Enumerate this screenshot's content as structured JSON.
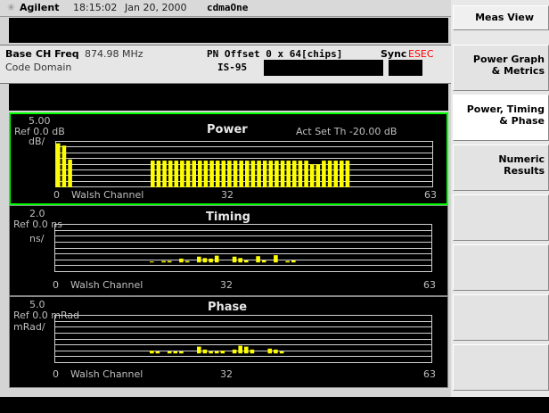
{
  "header": {
    "brand": "Agilent",
    "time": "18:15:02",
    "date": "Jan 20, 2000",
    "standard": "cdmaOne"
  },
  "info": {
    "base": "Base",
    "ch_freq_label": "CH Freq",
    "ch_freq_value": "874.98 MHz",
    "code_domain": "Code Domain",
    "pn_offset": "PN Offset 0 x 64[chips]",
    "is95": "IS-95",
    "sync_label": "Sync",
    "sync_value": "ESEC"
  },
  "colors": {
    "bar": "#ffff00",
    "sync_value": "#ff0000",
    "active_border": "#00ff00"
  },
  "softkeys": {
    "title": "Meas View",
    "items": [
      {
        "line1": "Power Graph",
        "line2": "& Metrics"
      },
      {
        "line1": "Power, Timing",
        "line2": "& Phase"
      },
      {
        "line1": "Numeric",
        "line2": "Results"
      },
      {
        "line1": "",
        "line2": ""
      },
      {
        "line1": "",
        "line2": ""
      },
      {
        "line1": "",
        "line2": ""
      },
      {
        "line1": "",
        "line2": ""
      }
    ]
  },
  "panels": [
    {
      "id": "power",
      "title": "Power",
      "ref": "Ref 0.0 dB",
      "scale": "5.00",
      "unit": "dB/",
      "extra": "Act Set Th  -20.00 dB",
      "x_start": "0",
      "x_axis_label": "Walsh Channel",
      "x_mid": "32",
      "x_end": "63"
    },
    {
      "id": "timing",
      "title": "Timing",
      "ref": "Ref 0.0 ns",
      "scale": "2.0",
      "unit": "ns/",
      "extra": "",
      "x_start": "0",
      "x_axis_label": "Walsh Channel",
      "x_mid": "32",
      "x_end": "63"
    },
    {
      "id": "phase",
      "title": "Phase",
      "ref": "Ref 0.0 mRad",
      "scale": "5.0",
      "unit": "mRad/",
      "extra": "",
      "x_start": "0",
      "x_axis_label": "Walsh Channel",
      "x_mid": "32",
      "x_end": "63"
    }
  ],
  "chart_data": [
    {
      "type": "bar",
      "title": "Power",
      "xlabel": "Walsh Channel",
      "ylabel": "dB",
      "x": [
        0,
        1,
        2,
        3,
        4,
        5,
        6,
        7,
        8,
        9,
        10,
        11,
        12,
        13,
        14,
        15,
        16,
        17,
        18,
        19,
        20,
        21,
        22,
        23,
        24,
        25,
        26,
        27,
        28,
        29,
        30,
        31,
        32,
        33,
        34,
        35,
        36,
        37,
        38,
        39,
        40,
        41,
        42,
        43,
        44,
        45,
        46,
        47,
        48,
        49,
        50,
        51,
        52,
        53,
        54,
        55,
        56,
        57,
        58,
        59,
        60,
        61,
        62,
        63
      ],
      "values": [
        -2,
        -4,
        -16,
        -40,
        -40,
        -40,
        -40,
        -40,
        -40,
        -40,
        -40,
        -40,
        -40,
        -40,
        -40,
        -40,
        -17,
        -17,
        -17,
        -17,
        -17,
        -17,
        -17,
        -17,
        -17,
        -17,
        -17,
        -17,
        -17,
        -17,
        -17,
        -17,
        -17,
        -17,
        -17,
        -17,
        -17,
        -17,
        -17,
        -17,
        -17,
        -17,
        -17,
        -20,
        -20,
        -17,
        -17,
        -17,
        -17,
        -17,
        -40,
        -40,
        -40,
        -40,
        -40,
        -40,
        -40,
        -40,
        -40,
        -40,
        -40,
        -40,
        -40,
        -40
      ],
      "baseline": -40,
      "xlim": [
        0,
        63
      ]
    },
    {
      "type": "bar",
      "title": "Timing",
      "xlabel": "Walsh Channel",
      "ylabel": "ns",
      "x": [
        16,
        18,
        19,
        21,
        22,
        24,
        25,
        26,
        27,
        30,
        31,
        32,
        34,
        35,
        37,
        39,
        40
      ],
      "values": [
        0.2,
        0.3,
        0.3,
        0.8,
        0.3,
        1.2,
        0.9,
        0.8,
        1.4,
        1.2,
        0.9,
        0.4,
        1.3,
        0.4,
        1.5,
        0.3,
        0.4
      ],
      "baseline": 0,
      "xlim": [
        0,
        63
      ]
    },
    {
      "type": "bar",
      "title": "Phase",
      "xlabel": "Walsh Channel",
      "ylabel": "mRad",
      "x": [
        16,
        17,
        19,
        20,
        21,
        24,
        25,
        26,
        27,
        28,
        30,
        31,
        32,
        33,
        36,
        37,
        38
      ],
      "values": [
        1.5,
        1.0,
        1.0,
        1.0,
        1.0,
        3.5,
        2.0,
        1.0,
        1.0,
        1.5,
        2.0,
        4.0,
        3.5,
        2.0,
        2.5,
        2.0,
        1.0
      ],
      "baseline": 0,
      "xlim": [
        0,
        63
      ]
    }
  ]
}
